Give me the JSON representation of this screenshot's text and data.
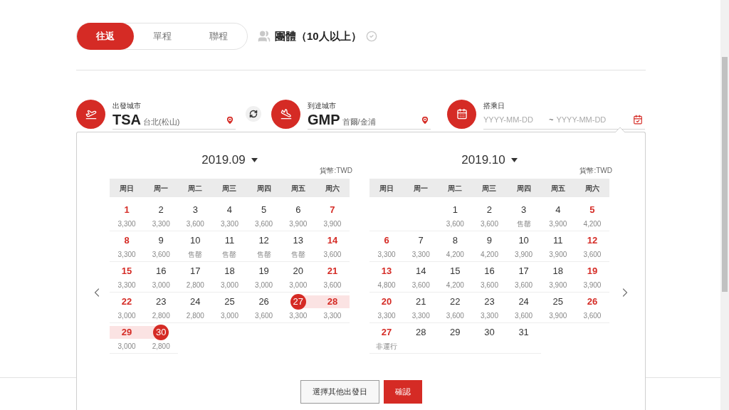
{
  "trip_tabs": [
    {
      "label": "往返",
      "selected": true
    },
    {
      "label": "單程",
      "selected": false
    },
    {
      "label": "聯程",
      "selected": false
    }
  ],
  "group_option": {
    "label": "團體（10人以上）",
    "checked": false
  },
  "cities": [
    {
      "kind": "departure",
      "label": "出發城市",
      "code": "TSA",
      "city": "台北(松山)"
    },
    {
      "kind": "arrival",
      "label": "到達城市",
      "code": "GMP",
      "city": "首爾/金浦"
    }
  ],
  "date_field": {
    "label": "搭乘日",
    "start_placeholder": "YYYY-MM-DD",
    "separator": "~",
    "end_placeholder": "YYYY-MM-DD"
  },
  "calendar": {
    "months": [
      {
        "title": "2019.09",
        "currency": "貨幣:TWD",
        "weekdays": [
          "周日",
          "周一",
          "周二",
          "周三",
          "周四",
          "周五",
          "周六"
        ],
        "days": [
          {
            "kind": "date",
            "day": "1",
            "price": "3,300",
            "holiday": true,
            "selected": false,
            "in_range": false
          },
          {
            "kind": "date",
            "day": "2",
            "price": "3,300",
            "holiday": false,
            "selected": false,
            "in_range": false
          },
          {
            "kind": "date",
            "day": "3",
            "price": "3,600",
            "holiday": false,
            "selected": false,
            "in_range": false
          },
          {
            "kind": "date",
            "day": "4",
            "price": "3,300",
            "holiday": false,
            "selected": false,
            "in_range": false
          },
          {
            "kind": "date",
            "day": "5",
            "price": "3,600",
            "holiday": false,
            "selected": false,
            "in_range": false
          },
          {
            "kind": "date",
            "day": "6",
            "price": "3,900",
            "holiday": false,
            "selected": false,
            "in_range": false
          },
          {
            "kind": "date",
            "day": "7",
            "price": "3,900",
            "holiday": true,
            "selected": false,
            "in_range": false
          },
          {
            "kind": "date",
            "day": "8",
            "price": "3,300",
            "holiday": true,
            "selected": false,
            "in_range": false
          },
          {
            "kind": "date",
            "day": "9",
            "price": "3,600",
            "holiday": false,
            "selected": false,
            "in_range": false
          },
          {
            "kind": "date",
            "day": "10",
            "price": "售罄",
            "holiday": false,
            "selected": false,
            "in_range": false
          },
          {
            "kind": "date",
            "day": "11",
            "price": "售罄",
            "holiday": false,
            "selected": false,
            "in_range": false
          },
          {
            "kind": "date",
            "day": "12",
            "price": "售罄",
            "holiday": false,
            "selected": false,
            "in_range": false
          },
          {
            "kind": "date",
            "day": "13",
            "price": "售罄",
            "holiday": false,
            "selected": false,
            "in_range": false
          },
          {
            "kind": "date",
            "day": "14",
            "price": "3,600",
            "holiday": true,
            "selected": false,
            "in_range": false
          },
          {
            "kind": "date",
            "day": "15",
            "price": "3,300",
            "holiday": true,
            "selected": false,
            "in_range": false
          },
          {
            "kind": "date",
            "day": "16",
            "price": "3,000",
            "holiday": false,
            "selected": false,
            "in_range": false
          },
          {
            "kind": "date",
            "day": "17",
            "price": "2,800",
            "holiday": false,
            "selected": false,
            "in_range": false
          },
          {
            "kind": "date",
            "day": "18",
            "price": "3,000",
            "holiday": false,
            "selected": false,
            "in_range": false
          },
          {
            "kind": "date",
            "day": "19",
            "price": "3,000",
            "holiday": false,
            "selected": false,
            "in_range": false
          },
          {
            "kind": "date",
            "day": "20",
            "price": "3,000",
            "holiday": false,
            "selected": false,
            "in_range": false
          },
          {
            "kind": "date",
            "day": "21",
            "price": "3,600",
            "holiday": true,
            "selected": false,
            "in_range": false
          },
          {
            "kind": "date",
            "day": "22",
            "price": "3,000",
            "holiday": true,
            "selected": false,
            "in_range": false
          },
          {
            "kind": "date",
            "day": "23",
            "price": "2,800",
            "holiday": false,
            "selected": false,
            "in_range": false
          },
          {
            "kind": "date",
            "day": "24",
            "price": "2,800",
            "holiday": false,
            "selected": false,
            "in_range": false
          },
          {
            "kind": "date",
            "day": "25",
            "price": "3,000",
            "holiday": false,
            "selected": false,
            "in_range": false
          },
          {
            "kind": "date",
            "day": "26",
            "price": "3,600",
            "holiday": false,
            "selected": false,
            "in_range": false
          },
          {
            "kind": "date",
            "day": "27",
            "price": "3,300",
            "holiday": false,
            "selected": true,
            "in_range": true
          },
          {
            "kind": "date",
            "day": "28",
            "price": "3,300",
            "holiday": true,
            "selected": false,
            "in_range": true
          },
          {
            "kind": "date",
            "day": "29",
            "price": "3,000",
            "holiday": true,
            "selected": false,
            "in_range": true
          },
          {
            "kind": "date",
            "day": "30",
            "price": "2,800",
            "holiday": false,
            "selected": true,
            "in_range": true
          }
        ]
      },
      {
        "title": "2019.10",
        "currency": "貨幣:TWD",
        "weekdays": [
          "周日",
          "周一",
          "周二",
          "周三",
          "周四",
          "周五",
          "周六"
        ],
        "days": [
          {
            "kind": "blank"
          },
          {
            "kind": "blank"
          },
          {
            "kind": "date",
            "day": "1",
            "price": "3,600",
            "holiday": false,
            "selected": false,
            "in_range": false
          },
          {
            "kind": "date",
            "day": "2",
            "price": "3,600",
            "holiday": false,
            "selected": false,
            "in_range": false
          },
          {
            "kind": "date",
            "day": "3",
            "price": "售罄",
            "holiday": false,
            "selected": false,
            "in_range": false
          },
          {
            "kind": "date",
            "day": "4",
            "price": "3,900",
            "holiday": false,
            "selected": false,
            "in_range": false
          },
          {
            "kind": "date",
            "day": "5",
            "price": "4,200",
            "holiday": true,
            "selected": false,
            "in_range": false
          },
          {
            "kind": "date",
            "day": "6",
            "price": "3,300",
            "holiday": true,
            "selected": false,
            "in_range": false
          },
          {
            "kind": "date",
            "day": "7",
            "price": "3,300",
            "holiday": false,
            "selected": false,
            "in_range": false
          },
          {
            "kind": "date",
            "day": "8",
            "price": "4,200",
            "holiday": false,
            "selected": false,
            "in_range": false
          },
          {
            "kind": "date",
            "day": "9",
            "price": "4,200",
            "holiday": false,
            "selected": false,
            "in_range": false
          },
          {
            "kind": "date",
            "day": "10",
            "price": "3,900",
            "holiday": false,
            "selected": false,
            "in_range": false
          },
          {
            "kind": "date",
            "day": "11",
            "price": "3,900",
            "holiday": false,
            "selected": false,
            "in_range": false
          },
          {
            "kind": "date",
            "day": "12",
            "price": "3,600",
            "holiday": true,
            "selected": false,
            "in_range": false
          },
          {
            "kind": "date",
            "day": "13",
            "price": "4,800",
            "holiday": true,
            "selected": false,
            "in_range": false
          },
          {
            "kind": "date",
            "day": "14",
            "price": "3,600",
            "holiday": false,
            "selected": false,
            "in_range": false
          },
          {
            "kind": "date",
            "day": "15",
            "price": "4,200",
            "holiday": false,
            "selected": false,
            "in_range": false
          },
          {
            "kind": "date",
            "day": "16",
            "price": "3,600",
            "holiday": false,
            "selected": false,
            "in_range": false
          },
          {
            "kind": "date",
            "day": "17",
            "price": "3,600",
            "holiday": false,
            "selected": false,
            "in_range": false
          },
          {
            "kind": "date",
            "day": "18",
            "price": "3,900",
            "holiday": false,
            "selected": false,
            "in_range": false
          },
          {
            "kind": "date",
            "day": "19",
            "price": "3,900",
            "holiday": true,
            "selected": false,
            "in_range": false
          },
          {
            "kind": "date",
            "day": "20",
            "price": "3,300",
            "holiday": true,
            "selected": false,
            "in_range": false
          },
          {
            "kind": "date",
            "day": "21",
            "price": "3,300",
            "holiday": false,
            "selected": false,
            "in_range": false
          },
          {
            "kind": "date",
            "day": "22",
            "price": "3,600",
            "holiday": false,
            "selected": false,
            "in_range": false
          },
          {
            "kind": "date",
            "day": "23",
            "price": "3,300",
            "holiday": false,
            "selected": false,
            "in_range": false
          },
          {
            "kind": "date",
            "day": "24",
            "price": "3,600",
            "holiday": false,
            "selected": false,
            "in_range": false
          },
          {
            "kind": "date",
            "day": "25",
            "price": "3,900",
            "holiday": false,
            "selected": false,
            "in_range": false
          },
          {
            "kind": "date",
            "day": "26",
            "price": "3,600",
            "holiday": true,
            "selected": false,
            "in_range": false
          },
          {
            "kind": "date",
            "day": "27",
            "price": "非運行",
            "holiday": true,
            "selected": false,
            "in_range": false
          },
          {
            "kind": "date",
            "day": "28",
            "holiday": false,
            "selected": false,
            "in_range": false
          },
          {
            "kind": "date",
            "day": "29",
            "holiday": false,
            "selected": false,
            "in_range": false
          },
          {
            "kind": "date",
            "day": "30",
            "holiday": false,
            "selected": false,
            "in_range": false
          },
          {
            "kind": "date",
            "day": "31",
            "holiday": false,
            "selected": false,
            "in_range": false
          }
        ]
      }
    ],
    "buttons": [
      {
        "kind": "secondary",
        "label": "選擇其他出發日"
      },
      {
        "kind": "primary",
        "label": "確認"
      }
    ]
  }
}
